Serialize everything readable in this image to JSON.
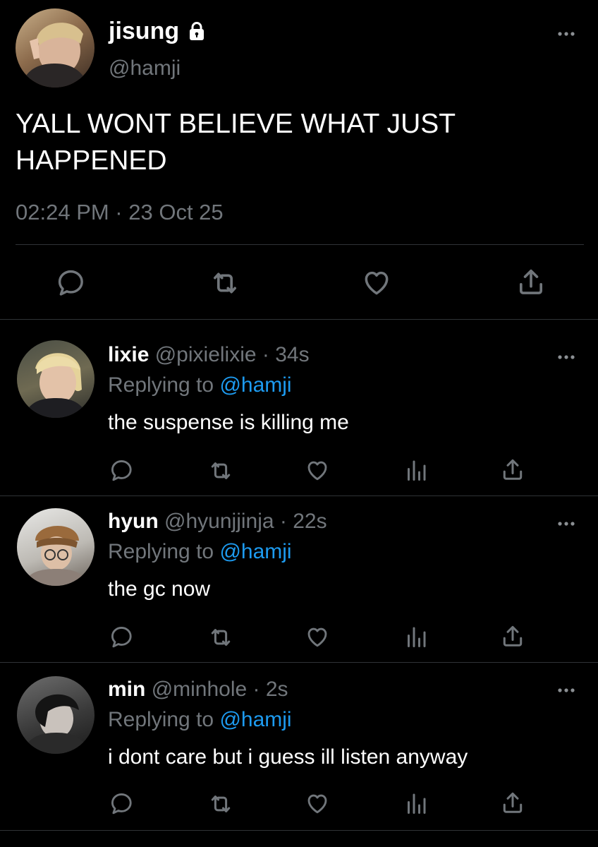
{
  "tweet": {
    "name": "jisung",
    "handle": "@hamji",
    "text": "YALL WONT BELIEVE WHAT JUST HAPPENED",
    "timestamp": "02:24 PM · 23 Oct 25",
    "locked": true
  },
  "replies": [
    {
      "name": "lixie",
      "handle": "@pixielixie",
      "age": "· 34s",
      "replying_prefix": "Replying to",
      "replying_handle": "@hamji",
      "text": "the suspense is killing me"
    },
    {
      "name": "hyun",
      "handle": "@hyunjjinja",
      "age": "· 22s",
      "replying_prefix": "Replying to",
      "replying_handle": "@hamji",
      "text": "the gc now"
    },
    {
      "name": "min",
      "handle": "@minhole",
      "age": "· 2s",
      "replying_prefix": "Replying to",
      "replying_handle": "@hamji",
      "text": "i dont care but i guess ill listen anyway"
    }
  ],
  "icons": [
    "lock-icon",
    "more-icon",
    "reply-icon",
    "retweet-icon",
    "like-icon",
    "analytics-icon",
    "share-icon"
  ],
  "colors": {
    "background": "#000000",
    "text": "#ffffff",
    "secondary": "#71767b",
    "accent": "#1d9bf0",
    "divider": "#2f3336"
  }
}
